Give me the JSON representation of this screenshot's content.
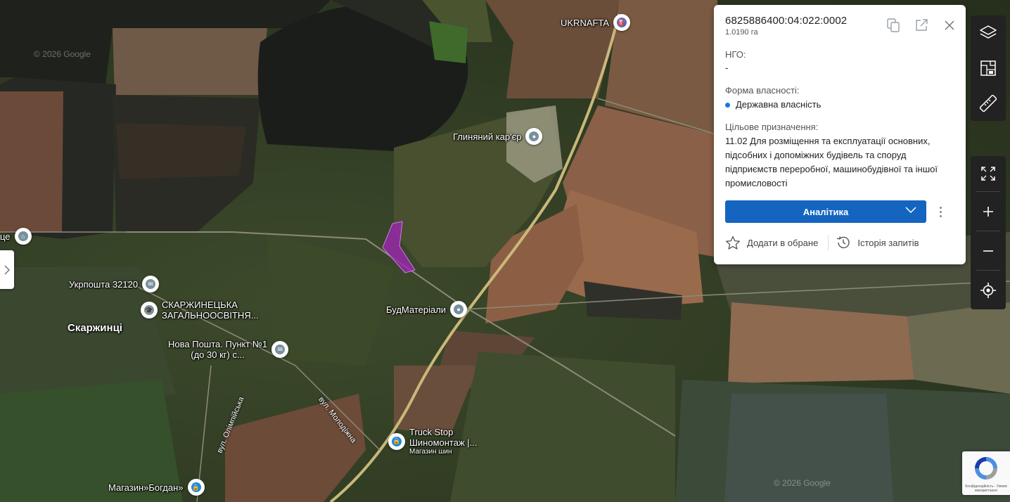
{
  "map": {
    "watermarks": [
      "© 2026 Google",
      "© 2026 Google",
      "© 2026 Google"
    ],
    "town": "Скаржинці",
    "streets": [
      "вул. Молодіжна",
      "вул. Олімпійська"
    ],
    "partial_label": "це",
    "pois": [
      {
        "id": "ukrnafta",
        "label": "UKRNAFTA",
        "sub": "",
        "icon": "fuel-station-icon",
        "color": "#5c6bc0"
      },
      {
        "id": "quarry",
        "label": "Глиняний кар'єр",
        "sub": "",
        "icon": "location-icon",
        "color": "#78909c"
      },
      {
        "id": "ukrposhta",
        "label": "Укрпошта 32120",
        "sub": "",
        "icon": "mail-icon",
        "color": "#78909c"
      },
      {
        "id": "school",
        "label": "СКАРЖИНЕЦЬКА",
        "label2": "ЗАГАЛЬНООСВІТНЯ...",
        "icon": "school-icon",
        "color": "#78909c"
      },
      {
        "id": "budmat",
        "label": "БудМатеріали",
        "sub": "",
        "icon": "location-icon",
        "color": "#78909c"
      },
      {
        "id": "novaposhta",
        "label": "Нова Пошта. Пункт №1",
        "label2": "(до 30 кг) с...",
        "icon": "mail-icon",
        "color": "#78909c"
      },
      {
        "id": "truckstop",
        "label": "Truck Stop",
        "label2": "Шиномонтаж |...",
        "sub": "Магазин шин",
        "icon": "shopping-bag-icon",
        "color": "#1e88e5"
      },
      {
        "id": "bogdan",
        "label": "Магазин»Богдан»",
        "sub": "",
        "icon": "shopping-bag-icon",
        "color": "#1e88e5"
      },
      {
        "id": "partial",
        "label": "",
        "sub": "",
        "icon": "museum-icon",
        "color": "#78909c"
      }
    ],
    "parcel_color": "#9c27b0"
  },
  "card": {
    "cadastral_number": "6825886400:04:022:0002",
    "area": "1.0190 га",
    "ngo_label": "НГО:",
    "ngo_value": "-",
    "ownership_label": "Форма власності:",
    "ownership_value": "Державна власність",
    "purpose_label": "Цільове призначення:",
    "purpose_value": "11.02 Для розміщення та експлуатації основних, підсобних і допоміжних будівель та споруд підприємств переробної, машинобудівної та іншої промисловості",
    "analytics_label": "Аналітика",
    "favorite_label": "Додати в обране",
    "history_label": "Історія запитів",
    "accent": "#1565c0"
  },
  "toolbar": {
    "top": [
      "layers-icon",
      "cadastre-icon",
      "ruler-icon"
    ],
    "bottom": [
      "fullscreen-icon",
      "zoom-in-icon",
      "zoom-out-icon",
      "locate-icon"
    ]
  },
  "recaptcha": {
    "text": "Конфіденційність - Умови використання"
  }
}
